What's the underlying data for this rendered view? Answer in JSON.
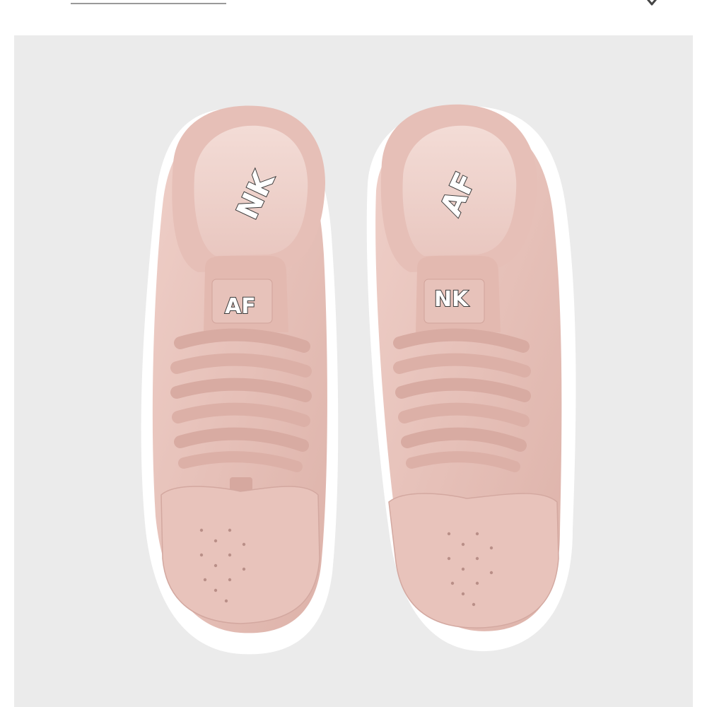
{
  "header": {
    "back_link_label": "",
    "close_icon": "close-icon"
  },
  "product_image": {
    "icon": "sneaker-photo",
    "colors": {
      "background": "#ebebeb",
      "upper": "#e8c4bc",
      "upper_shadow": "#d9aea5",
      "lining": "#f1d6d0",
      "sole": "#ffffff",
      "logo_stroke": "#3a3a3a"
    },
    "left_shoe": {
      "insole_logo": "NK",
      "tongue_logo": "AF"
    },
    "right_shoe": {
      "insole_logo": "AF",
      "tongue_logo": "NK"
    }
  }
}
